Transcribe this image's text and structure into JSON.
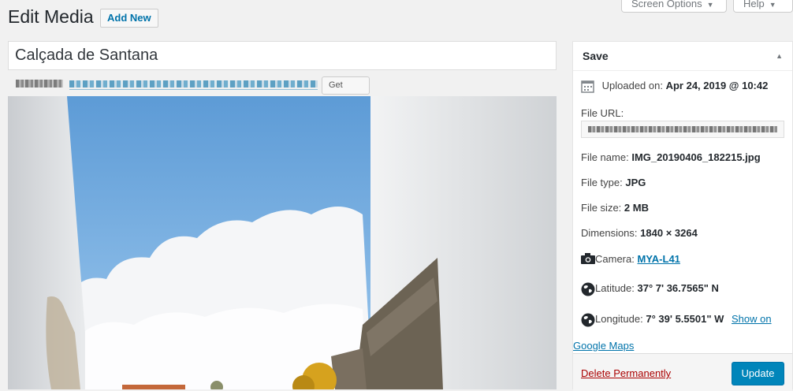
{
  "header": {
    "title": "Edit Media",
    "add_new": "Add New",
    "screen_options": "Screen Options",
    "help": "Help"
  },
  "title_input": {
    "value": "Calçada de Santana"
  },
  "permalink": {
    "shortlink_button": "Get Shortlink"
  },
  "sidebar": {
    "title": "Save",
    "uploaded_label": "Uploaded on:",
    "uploaded_value": "Apr 24, 2019 @ 10:42",
    "file_url_label": "File URL:",
    "file_name_label": "File name:",
    "file_name_value": "IMG_20190406_182215.jpg",
    "file_type_label": "File type:",
    "file_type_value": "JPG",
    "file_size_label": "File size:",
    "file_size_value": "2 MB",
    "dimensions_label": "Dimensions:",
    "dimensions_value": "1840 × 3264",
    "camera_label": "Camera:",
    "camera_value": "MYA-L41",
    "latitude_label": "Latitude:",
    "latitude_value": "37° 7' 36.7565\" N",
    "longitude_label": "Longitude:",
    "longitude_value": "7° 39' 5.5501\" W",
    "show_on": "Show on",
    "google_maps": "Google Maps",
    "delete": "Delete Permanently",
    "update": "Update"
  },
  "icons": {
    "calendar": "calendar-icon",
    "camera": "camera-icon",
    "globe": "globe-icon",
    "caret": "caret-up-icon"
  }
}
